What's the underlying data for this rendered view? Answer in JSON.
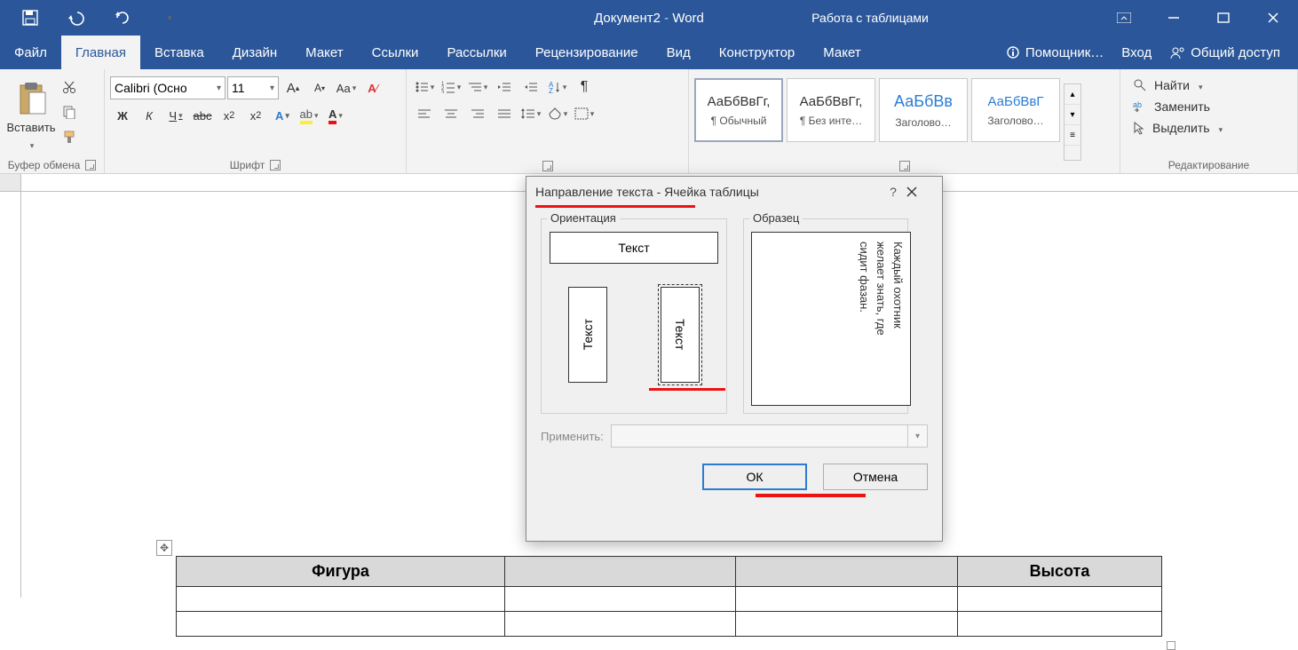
{
  "titlebar": {
    "doc_title": "Документ2",
    "app_name": "Word",
    "table_tools": "Работа с таблицами"
  },
  "tabs": {
    "file": "Файл",
    "home": "Главная",
    "insert": "Вставка",
    "design": "Дизайн",
    "layout": "Макет",
    "references": "Ссылки",
    "mailings": "Рассылки",
    "review": "Рецензирование",
    "view": "Вид",
    "construct": "Конструктор",
    "tbl_layout": "Макет",
    "tell_me": "Помощник…",
    "sign_in": "Вход",
    "share": "Общий доступ"
  },
  "ribbon": {
    "clipboard": {
      "paste": "Вставить",
      "label": "Буфер обмена"
    },
    "font": {
      "name": "Calibri (Осно",
      "size": "11",
      "label": "Шрифт",
      "bold": "Ж",
      "italic": "К",
      "underline": "Ч"
    },
    "styles": {
      "items": [
        {
          "preview": "АаБбВвГг,",
          "name": "¶ Обычный"
        },
        {
          "preview": "АаБбВвГг,",
          "name": "¶ Без инте…"
        },
        {
          "preview": "АаБбВв",
          "name": "Заголово…"
        },
        {
          "preview": "АаБбВвГ",
          "name": "Заголово…"
        }
      ]
    },
    "editing": {
      "find": "Найти",
      "replace": "Заменить",
      "select": "Выделить",
      "label": "Редактирование"
    }
  },
  "table": {
    "col1": "Фигура",
    "col4": "Высота"
  },
  "dialog": {
    "title": "Направление текста - Ячейка таблицы",
    "orientation": "Ориентация",
    "sample": "Образец",
    "text": "Текст",
    "sample_text": [
      "Каждый охотник",
      "желает знать, где",
      "сидит фазан."
    ],
    "apply": "Применить:",
    "ok": "ОК",
    "cancel": "Отмена"
  }
}
